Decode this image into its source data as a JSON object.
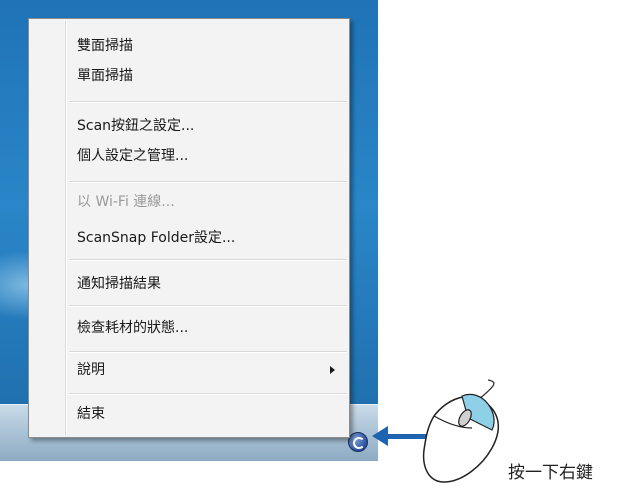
{
  "menu": {
    "items": [
      {
        "label": "雙面掃描"
      },
      {
        "label": "單面掃描"
      },
      {
        "label": "Scan按鈕之設定..."
      },
      {
        "label": "個人設定之管理..."
      },
      {
        "label": "以 Wi-Fi 連線..."
      },
      {
        "label": "ScanSnap Folder設定..."
      },
      {
        "label": "通知掃描結果"
      },
      {
        "label": "檢查耗材的狀態..."
      },
      {
        "label": "說明"
      },
      {
        "label": "結束"
      }
    ]
  },
  "tray": {
    "icon": "scansnap-manager-icon"
  },
  "annotation": {
    "caption": "按一下右鍵",
    "arrow_color": "#1e63b0"
  }
}
